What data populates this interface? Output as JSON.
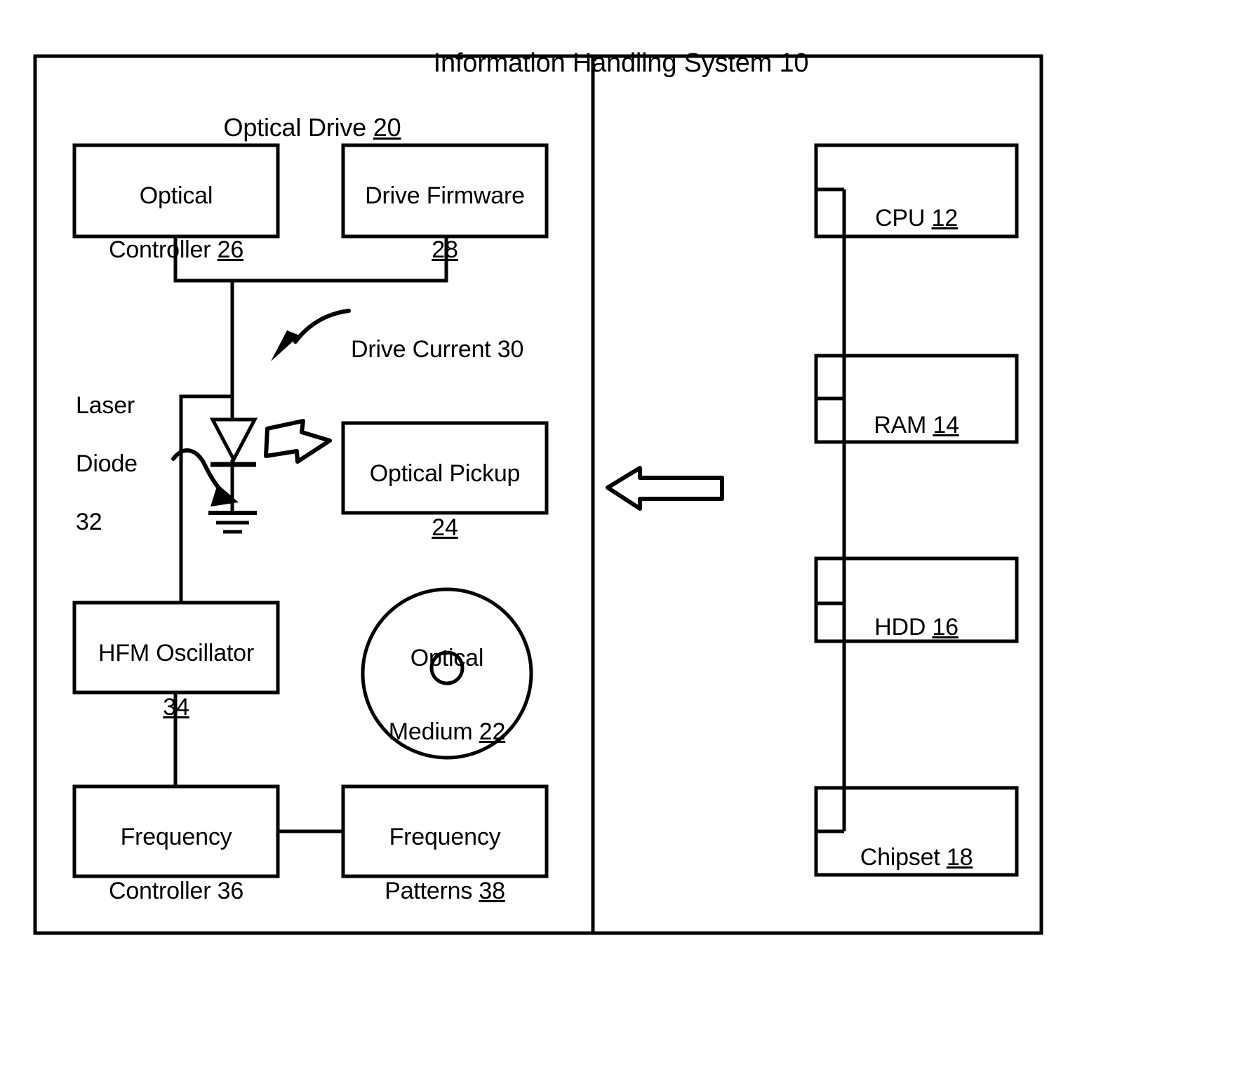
{
  "figure": {
    "title": "Information Handling System 10",
    "title_ref": "10",
    "stroke_color": "#000000",
    "background_color": "#ffffff"
  },
  "left_panel": {
    "title_text": "Optical Drive ",
    "title_ref": "20",
    "boxes": [
      {
        "id": "optical-controller",
        "line1": "Optical",
        "line2": "Controller ",
        "ref": "26"
      },
      {
        "id": "drive-firmware",
        "line1": "Drive Firmware",
        "line2": "",
        "ref": "28"
      },
      {
        "id": "optical-pickup",
        "line1": "Optical Pickup",
        "line2": "",
        "ref": "24"
      },
      {
        "id": "hfm-oscillator",
        "line1": "HFM Oscillator",
        "line2": "",
        "ref": "34"
      },
      {
        "id": "frequency-controller",
        "line1": "Frequency",
        "line2": "Controller 36",
        "ref": "36"
      },
      {
        "id": "frequency-patterns",
        "line1": "Frequency",
        "line2": "Patterns ",
        "ref": "38"
      }
    ],
    "annotations": {
      "drive_current": "Drive Current 30",
      "laser_diode_l1": "Laser",
      "laser_diode_l2": "Diode",
      "laser_diode_l3": "32"
    },
    "optical_medium": {
      "line1": "Optical",
      "line2": "Medium ",
      "ref": "22"
    }
  },
  "right_panel": {
    "boxes": [
      {
        "id": "cpu",
        "label": "CPU ",
        "ref": "12"
      },
      {
        "id": "ram",
        "label": "RAM ",
        "ref": "14"
      },
      {
        "id": "hdd",
        "label": "HDD ",
        "ref": "16"
      },
      {
        "id": "chipset",
        "label": "Chipset ",
        "ref": "18"
      }
    ]
  },
  "icons": {
    "laser_beam_arrow": "block-arrow-right-icon",
    "interconnect_arrow": "block-arrow-left-icon",
    "diode_symbol": "laser-diode-icon",
    "ground_symbol": "ground-icon",
    "disc_symbol": "optical-disc-icon"
  }
}
